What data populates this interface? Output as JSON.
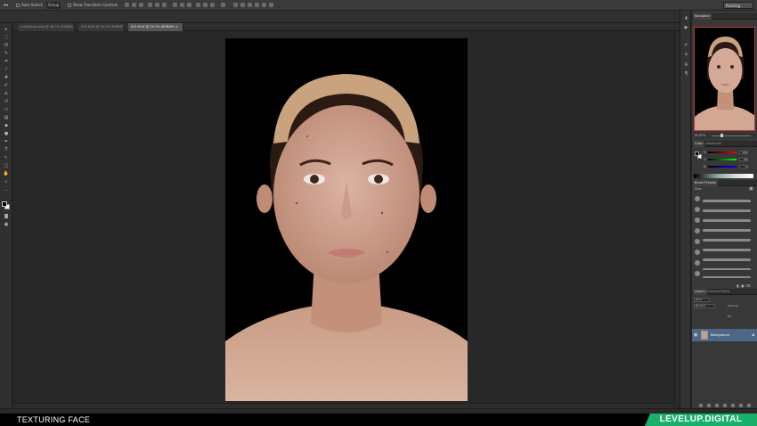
{
  "options_bar": {
    "auto_select_label": "Auto-Select:",
    "auto_select_value": "Group",
    "show_transform_label": "Show Transform Controls",
    "workspace_label": "Painting"
  },
  "document_tabs": [
    {
      "label": "untitleadoc.psd @ 16.7% (RGB/8)"
    },
    {
      "label": "001.M.tif @ 16.7% (RGB/8)"
    },
    {
      "label": "001.M.tif @ 16.7% (RGB/8*)"
    }
  ],
  "navigator": {
    "tab_label": "Navigator",
    "zoom_label": "16.67%"
  },
  "color_panel": {
    "tabs": [
      "Color",
      "Swatches"
    ],
    "sliders": [
      {
        "label": "R",
        "value": "160"
      },
      {
        "label": "G",
        "value": "96"
      },
      {
        "label": "B",
        "value": "0"
      }
    ]
  },
  "brushes_panel": {
    "tabs": [
      "Brush Presets"
    ],
    "size_label": "Size:"
  },
  "layers_panel": {
    "tabs": [
      "Layers",
      "Channels",
      "Paths"
    ],
    "kind_label": "Kind",
    "blend_mode": "Normal",
    "opacity_label": "Opacity:",
    "fill_label": "Fill:",
    "layer_name": "Background"
  },
  "caption": {
    "title": "TEXTURING FACE",
    "brand": "LEVELUP.DIGITAL"
  },
  "colors": {
    "accent_brand": "#19b06b",
    "selected_layer": "#4d6787"
  }
}
